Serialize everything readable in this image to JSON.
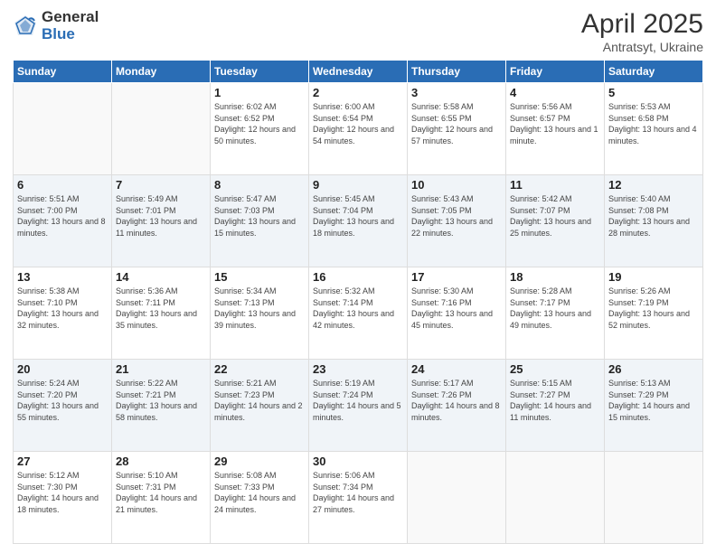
{
  "logo": {
    "general": "General",
    "blue": "Blue"
  },
  "title": {
    "month": "April 2025",
    "location": "Antratsyt, Ukraine"
  },
  "headers": [
    "Sunday",
    "Monday",
    "Tuesday",
    "Wednesday",
    "Thursday",
    "Friday",
    "Saturday"
  ],
  "weeks": [
    [
      {
        "day": "",
        "info": ""
      },
      {
        "day": "",
        "info": ""
      },
      {
        "day": "1",
        "info": "Sunrise: 6:02 AM\nSunset: 6:52 PM\nDaylight: 12 hours and 50 minutes."
      },
      {
        "day": "2",
        "info": "Sunrise: 6:00 AM\nSunset: 6:54 PM\nDaylight: 12 hours and 54 minutes."
      },
      {
        "day": "3",
        "info": "Sunrise: 5:58 AM\nSunset: 6:55 PM\nDaylight: 12 hours and 57 minutes."
      },
      {
        "day": "4",
        "info": "Sunrise: 5:56 AM\nSunset: 6:57 PM\nDaylight: 13 hours and 1 minute."
      },
      {
        "day": "5",
        "info": "Sunrise: 5:53 AM\nSunset: 6:58 PM\nDaylight: 13 hours and 4 minutes."
      }
    ],
    [
      {
        "day": "6",
        "info": "Sunrise: 5:51 AM\nSunset: 7:00 PM\nDaylight: 13 hours and 8 minutes."
      },
      {
        "day": "7",
        "info": "Sunrise: 5:49 AM\nSunset: 7:01 PM\nDaylight: 13 hours and 11 minutes."
      },
      {
        "day": "8",
        "info": "Sunrise: 5:47 AM\nSunset: 7:03 PM\nDaylight: 13 hours and 15 minutes."
      },
      {
        "day": "9",
        "info": "Sunrise: 5:45 AM\nSunset: 7:04 PM\nDaylight: 13 hours and 18 minutes."
      },
      {
        "day": "10",
        "info": "Sunrise: 5:43 AM\nSunset: 7:05 PM\nDaylight: 13 hours and 22 minutes."
      },
      {
        "day": "11",
        "info": "Sunrise: 5:42 AM\nSunset: 7:07 PM\nDaylight: 13 hours and 25 minutes."
      },
      {
        "day": "12",
        "info": "Sunrise: 5:40 AM\nSunset: 7:08 PM\nDaylight: 13 hours and 28 minutes."
      }
    ],
    [
      {
        "day": "13",
        "info": "Sunrise: 5:38 AM\nSunset: 7:10 PM\nDaylight: 13 hours and 32 minutes."
      },
      {
        "day": "14",
        "info": "Sunrise: 5:36 AM\nSunset: 7:11 PM\nDaylight: 13 hours and 35 minutes."
      },
      {
        "day": "15",
        "info": "Sunrise: 5:34 AM\nSunset: 7:13 PM\nDaylight: 13 hours and 39 minutes."
      },
      {
        "day": "16",
        "info": "Sunrise: 5:32 AM\nSunset: 7:14 PM\nDaylight: 13 hours and 42 minutes."
      },
      {
        "day": "17",
        "info": "Sunrise: 5:30 AM\nSunset: 7:16 PM\nDaylight: 13 hours and 45 minutes."
      },
      {
        "day": "18",
        "info": "Sunrise: 5:28 AM\nSunset: 7:17 PM\nDaylight: 13 hours and 49 minutes."
      },
      {
        "day": "19",
        "info": "Sunrise: 5:26 AM\nSunset: 7:19 PM\nDaylight: 13 hours and 52 minutes."
      }
    ],
    [
      {
        "day": "20",
        "info": "Sunrise: 5:24 AM\nSunset: 7:20 PM\nDaylight: 13 hours and 55 minutes."
      },
      {
        "day": "21",
        "info": "Sunrise: 5:22 AM\nSunset: 7:21 PM\nDaylight: 13 hours and 58 minutes."
      },
      {
        "day": "22",
        "info": "Sunrise: 5:21 AM\nSunset: 7:23 PM\nDaylight: 14 hours and 2 minutes."
      },
      {
        "day": "23",
        "info": "Sunrise: 5:19 AM\nSunset: 7:24 PM\nDaylight: 14 hours and 5 minutes."
      },
      {
        "day": "24",
        "info": "Sunrise: 5:17 AM\nSunset: 7:26 PM\nDaylight: 14 hours and 8 minutes."
      },
      {
        "day": "25",
        "info": "Sunrise: 5:15 AM\nSunset: 7:27 PM\nDaylight: 14 hours and 11 minutes."
      },
      {
        "day": "26",
        "info": "Sunrise: 5:13 AM\nSunset: 7:29 PM\nDaylight: 14 hours and 15 minutes."
      }
    ],
    [
      {
        "day": "27",
        "info": "Sunrise: 5:12 AM\nSunset: 7:30 PM\nDaylight: 14 hours and 18 minutes."
      },
      {
        "day": "28",
        "info": "Sunrise: 5:10 AM\nSunset: 7:31 PM\nDaylight: 14 hours and 21 minutes."
      },
      {
        "day": "29",
        "info": "Sunrise: 5:08 AM\nSunset: 7:33 PM\nDaylight: 14 hours and 24 minutes."
      },
      {
        "day": "30",
        "info": "Sunrise: 5:06 AM\nSunset: 7:34 PM\nDaylight: 14 hours and 27 minutes."
      },
      {
        "day": "",
        "info": ""
      },
      {
        "day": "",
        "info": ""
      },
      {
        "day": "",
        "info": ""
      }
    ]
  ]
}
